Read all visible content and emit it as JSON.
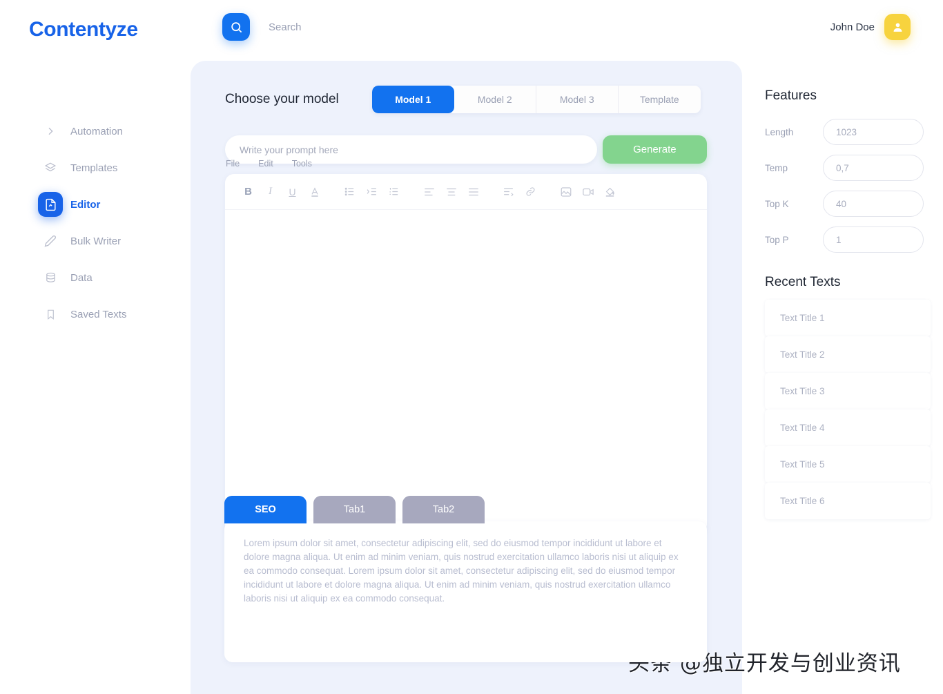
{
  "app": {
    "logo": "Contentyze"
  },
  "topbar": {
    "search_placeholder": "Search",
    "search_value": "",
    "search_icon": "search-icon",
    "user_name": "John Doe",
    "avatar_icon": "user-icon"
  },
  "sidebar": {
    "items": [
      {
        "label": "Automation",
        "icon": "chevron-right-icon",
        "active": false
      },
      {
        "label": "Templates",
        "icon": "layers-icon",
        "active": false
      },
      {
        "label": "Editor",
        "icon": "document-edit-icon",
        "active": true
      },
      {
        "label": "Bulk Writer",
        "icon": "pen-icon",
        "active": false
      },
      {
        "label": "Data",
        "icon": "database-icon",
        "active": false
      },
      {
        "label": "Saved Texts",
        "icon": "bookmark-icon",
        "active": false
      }
    ]
  },
  "main": {
    "choose_title": "Choose your model",
    "model_tabs": [
      {
        "label": "Model 1",
        "active": true
      },
      {
        "label": "Model 2",
        "active": false
      },
      {
        "label": "Model 3",
        "active": false
      },
      {
        "label": "Template",
        "active": false
      }
    ],
    "prompt_placeholder": "Write your prompt here",
    "prompt_value": "",
    "generate_label": "Generate",
    "menu": [
      "File",
      "Edit",
      "Tools"
    ],
    "toolbar_icons": [
      "bold-icon",
      "italic-icon",
      "underline-icon",
      "text-color-icon",
      "bulleted-list-icon",
      "indent-decrease-icon",
      "numbered-list-icon",
      "align-left-icon",
      "align-center-icon",
      "align-justify-icon",
      "indent-icon",
      "link-icon",
      "image-icon",
      "video-icon",
      "fill-color-icon"
    ],
    "editor_value": "",
    "editor_placeholder": ""
  },
  "bottom_tabs": {
    "tabs": [
      {
        "label": "SEO",
        "active": true
      },
      {
        "label": "Tab1",
        "active": false
      },
      {
        "label": "Tab2",
        "active": false
      }
    ],
    "body": "Lorem ipsum dolor sit amet, consectetur adipiscing elit, sed do eiusmod tempor incididunt ut labore et dolore magna aliqua. Ut enim ad minim veniam, quis nostrud exercitation ullamco laboris nisi ut aliquip ex ea commodo consequat. Lorem ipsum dolor sit amet, consectetur adipiscing elit, sed do eiusmod tempor incididunt ut labore et dolore magna aliqua. Ut enim ad minim veniam, quis nostrud exercitation ullamco laboris nisi ut aliquip ex ea commodo consequat."
  },
  "rail": {
    "features_title": "Features",
    "features": [
      {
        "label": "Length",
        "value": "1023"
      },
      {
        "label": "Temp",
        "value": "0,7"
      },
      {
        "label": "Top K",
        "value": "40"
      },
      {
        "label": "Top P",
        "value": "1"
      }
    ],
    "recent_title": "Recent Texts",
    "recent": [
      {
        "label": "Text Title 1"
      },
      {
        "label": "Text Title 2"
      },
      {
        "label": "Text Title 3"
      },
      {
        "label": "Text Title 4"
      },
      {
        "label": "Text Title 5"
      },
      {
        "label": "Text Title 6"
      }
    ]
  },
  "watermark": {
    "text": "头条 @独立开发与创业资讯"
  },
  "colors": {
    "brand_blue": "#1272ef",
    "logo_blue": "#1863e8",
    "generate_green": "#83d48e",
    "avatar_yellow": "#f7d33e",
    "panel_bg": "#eef2fc",
    "inactive_tab": "#a7a8be"
  }
}
